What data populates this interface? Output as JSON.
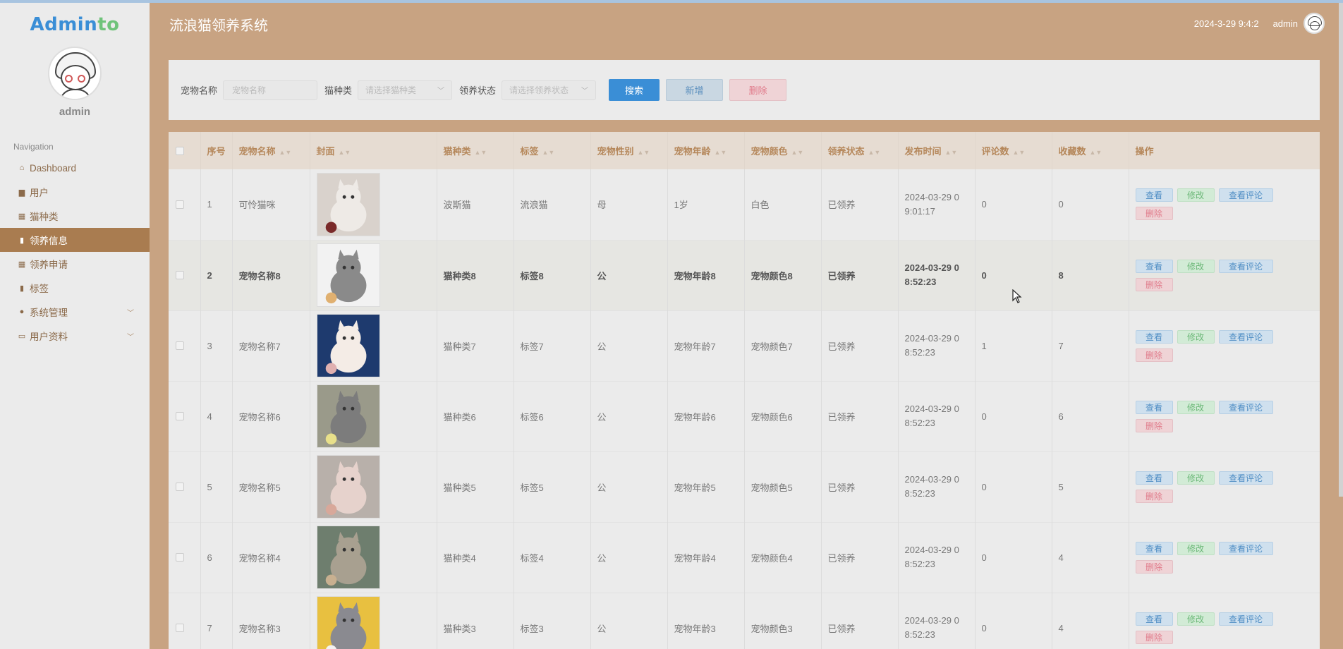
{
  "app": {
    "logo": "Adminto",
    "logo_part1": "Admin",
    "logo_part2": "to",
    "title": "流浪猫领养系统"
  },
  "user": {
    "name": "admin",
    "datetime": "2024-3-29 9:4:2"
  },
  "sidebar": {
    "nav_title": "Navigation",
    "items": [
      {
        "label": "Dashboard",
        "icon": "home-icon"
      },
      {
        "label": "用户",
        "icon": "briefcase-icon"
      },
      {
        "label": "猫种类",
        "icon": "grid-icon"
      },
      {
        "label": "领养信息",
        "icon": "book-icon",
        "active": true
      },
      {
        "label": "领养申请",
        "icon": "grid-icon"
      },
      {
        "label": "标签",
        "icon": "clipboard-icon"
      },
      {
        "label": "系统管理",
        "icon": "map-pin-icon",
        "expandable": true
      },
      {
        "label": "用户资料",
        "icon": "window-icon",
        "expandable": true
      }
    ]
  },
  "search": {
    "name_label": "宠物名称",
    "name_placeholder": "宠物名称",
    "type_label": "猫种类",
    "type_placeholder": "请选择猫种类",
    "status_label": "领养状态",
    "status_placeholder": "请选择领养状态",
    "search_button": "搜索",
    "add_button": "新增",
    "delete_button": "删除"
  },
  "table": {
    "columns": [
      "序号",
      "宠物名称",
      "封面",
      "猫种类",
      "标签",
      "宠物性别",
      "宠物年龄",
      "宠物颜色",
      "领养状态",
      "发布时间",
      "评论数",
      "收藏数",
      "操作"
    ],
    "actions": {
      "view": "查看",
      "edit": "修改",
      "comments": "查看评论",
      "delete": "删除"
    },
    "rows": [
      {
        "index": "1",
        "name": "可怜猫咪",
        "breed": "波斯猫",
        "tag": "流浪猫",
        "gender": "母",
        "age": "1岁",
        "color": "白色",
        "status": "已领养",
        "time_line1": "2024-03-29 0",
        "time_line2": "9:01:17",
        "comments": "0",
        "favorites": "0"
      },
      {
        "index": "2",
        "name": "宠物名称8",
        "breed": "猫种类8",
        "tag": "标签8",
        "gender": "公",
        "age": "宠物年龄8",
        "color": "宠物颜色8",
        "status": "已领养",
        "time_line1": "2024-03-29 0",
        "time_line2": "8:52:23",
        "comments": "0",
        "favorites": "8"
      },
      {
        "index": "3",
        "name": "宠物名称7",
        "breed": "猫种类7",
        "tag": "标签7",
        "gender": "公",
        "age": "宠物年龄7",
        "color": "宠物颜色7",
        "status": "已领养",
        "time_line1": "2024-03-29 0",
        "time_line2": "8:52:23",
        "comments": "1",
        "favorites": "7"
      },
      {
        "index": "4",
        "name": "宠物名称6",
        "breed": "猫种类6",
        "tag": "标签6",
        "gender": "公",
        "age": "宠物年龄6",
        "color": "宠物颜色6",
        "status": "已领养",
        "time_line1": "2024-03-29 0",
        "time_line2": "8:52:23",
        "comments": "0",
        "favorites": "6"
      },
      {
        "index": "5",
        "name": "宠物名称5",
        "breed": "猫种类5",
        "tag": "标签5",
        "gender": "公",
        "age": "宠物年龄5",
        "color": "宠物颜色5",
        "status": "已领养",
        "time_line1": "2024-03-29 0",
        "time_line2": "8:52:23",
        "comments": "0",
        "favorites": "5"
      },
      {
        "index": "6",
        "name": "宠物名称4",
        "breed": "猫种类4",
        "tag": "标签4",
        "gender": "公",
        "age": "宠物年龄4",
        "color": "宠物颜色4",
        "status": "已领养",
        "time_line1": "2024-03-29 0",
        "time_line2": "8:52:23",
        "comments": "0",
        "favorites": "4"
      },
      {
        "index": "7",
        "name": "宠物名称3",
        "breed": "猫种类3",
        "tag": "标签3",
        "gender": "公",
        "age": "宠物年龄3",
        "color": "宠物颜色3",
        "status": "已领养",
        "time_line1": "2024-03-29 0",
        "time_line2": "8:52:23",
        "comments": "0",
        "favorites": "4"
      }
    ]
  },
  "colors": {
    "accent": "#a97c50",
    "header_bg": "#c8a382",
    "primary": "#3a8ed6"
  }
}
